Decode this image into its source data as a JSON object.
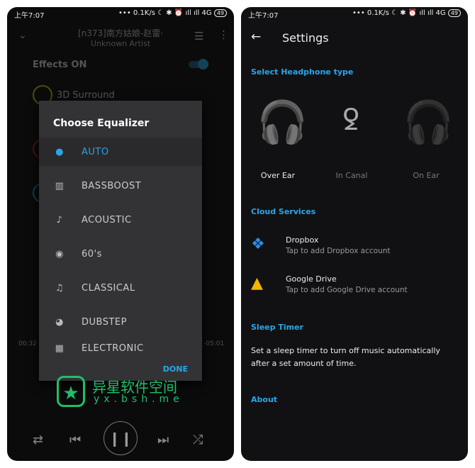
{
  "status": {
    "time": "上午7:07",
    "speed": "0.1K/s",
    "network": "4G",
    "battery": "49"
  },
  "player": {
    "title": "[n373]南方姑娘-赵雷·",
    "artist": "Unknown Artist",
    "effects_label": "Effects ON",
    "effects_on": true,
    "surround_label": "3D Surround",
    "elapsed": "00:32",
    "remaining": "-05:01"
  },
  "dialog": {
    "title": "Choose Equalizer",
    "items": [
      {
        "label": "AUTO",
        "icon": "auto-icon",
        "selected": true
      },
      {
        "label": "BASSBOOST",
        "icon": "amp-icon"
      },
      {
        "label": "ACOUSTIC",
        "icon": "guitar-icon"
      },
      {
        "label": "60's",
        "icon": "vinyl-icon"
      },
      {
        "label": "CLASSICAL",
        "icon": "violin-icon"
      },
      {
        "label": "DUBSTEP",
        "icon": "speaker-icon"
      },
      {
        "label": "ELECTRONIC",
        "icon": "keyboard-icon"
      }
    ],
    "done": "DONE"
  },
  "watermark": {
    "name": "异星软件空间",
    "url": "yx.bsh.me"
  },
  "settings": {
    "title": "Settings",
    "headphone_section": "Select Headphone type",
    "headphones": [
      {
        "label": "Over Ear",
        "selected": true
      },
      {
        "label": "In Canal"
      },
      {
        "label": "On Ear"
      }
    ],
    "cloud_section": "Cloud Services",
    "cloud": [
      {
        "title": "Dropbox",
        "subtitle": "Tap to add Dropbox account"
      },
      {
        "title": "Google Drive",
        "subtitle": "Tap to add Google Drive account"
      }
    ],
    "sleep_section": "Sleep Timer",
    "sleep_text": "Set a sleep timer to turn off music automatically after a set amount of time.",
    "about_section": "About"
  },
  "colors": {
    "accent": "#2aa6e8",
    "watermark": "#1fbf6a"
  }
}
